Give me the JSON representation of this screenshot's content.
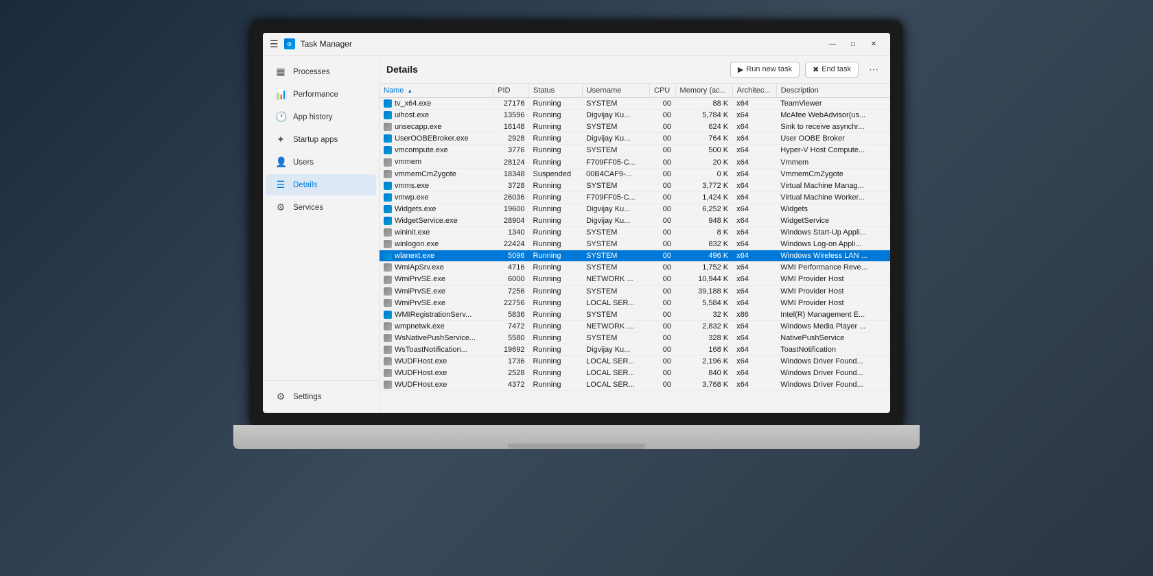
{
  "window": {
    "title": "Task Manager",
    "controls": {
      "minimize": "—",
      "maximize": "□",
      "close": "✕"
    }
  },
  "sidebar": {
    "items": [
      {
        "id": "processes",
        "label": "Processes",
        "icon": "☰"
      },
      {
        "id": "performance",
        "label": "Performance",
        "icon": "📈"
      },
      {
        "id": "app-history",
        "label": "App history",
        "icon": "🕐"
      },
      {
        "id": "startup-apps",
        "label": "Startup apps",
        "icon": "🚀"
      },
      {
        "id": "users",
        "label": "Users",
        "icon": "👤"
      },
      {
        "id": "details",
        "label": "Details",
        "icon": "☰"
      },
      {
        "id": "services",
        "label": "Services",
        "icon": "⚙"
      }
    ],
    "settings": "Settings"
  },
  "toolbar": {
    "tab_title": "Details",
    "run_new_task": "Run new task",
    "end_task": "End task"
  },
  "table": {
    "columns": [
      {
        "id": "name",
        "label": "Name",
        "sorted": true
      },
      {
        "id": "pid",
        "label": "PID"
      },
      {
        "id": "status",
        "label": "Status"
      },
      {
        "id": "username",
        "label": "Username"
      },
      {
        "id": "cpu",
        "label": "CPU"
      },
      {
        "id": "memory",
        "label": "Memory (ac..."
      },
      {
        "id": "arch",
        "label": "Architec..."
      },
      {
        "id": "description",
        "label": "Description"
      }
    ],
    "rows": [
      {
        "name": "tv_x64.exe",
        "pid": "27176",
        "status": "Running",
        "username": "SYSTEM",
        "cpu": "00",
        "memory": "88 K",
        "arch": "x64",
        "description": "TeamViewer",
        "icon": "blue",
        "selected": false,
        "highlighted": false
      },
      {
        "name": "uihost.exe",
        "pid": "13596",
        "status": "Running",
        "username": "Digvijay Ku...",
        "cpu": "00",
        "memory": "5,784 K",
        "arch": "x64",
        "description": "McAfee WebAdvisor(us...",
        "icon": "blue",
        "selected": false,
        "highlighted": false
      },
      {
        "name": "unsecapp.exe",
        "pid": "16148",
        "status": "Running",
        "username": "SYSTEM",
        "cpu": "00",
        "memory": "624 K",
        "arch": "x64",
        "description": "Sink to receive asynchr...",
        "icon": "gray",
        "selected": false,
        "highlighted": false
      },
      {
        "name": "UserOOBEBroker.exe",
        "pid": "2928",
        "status": "Running",
        "username": "Digvijay Ku...",
        "cpu": "00",
        "memory": "764 K",
        "arch": "x64",
        "description": "User OOBE Broker",
        "icon": "blue",
        "selected": false,
        "highlighted": false
      },
      {
        "name": "vmcompute.exe",
        "pid": "3776",
        "status": "Running",
        "username": "SYSTEM",
        "cpu": "00",
        "memory": "500 K",
        "arch": "x64",
        "description": "Hyper-V Host Compute...",
        "icon": "blue",
        "selected": false,
        "highlighted": false
      },
      {
        "name": "vmmem",
        "pid": "28124",
        "status": "Running",
        "username": "F709FF05-C...",
        "cpu": "00",
        "memory": "20 K",
        "arch": "x64",
        "description": "Vmmem",
        "icon": "gray",
        "selected": false,
        "highlighted": false
      },
      {
        "name": "vmmemCmZygote",
        "pid": "18348",
        "status": "Suspended",
        "username": "00B4CAF9-...",
        "cpu": "00",
        "memory": "0 K",
        "arch": "x64",
        "description": "VmmemCmZygote",
        "icon": "gray",
        "selected": false,
        "highlighted": false
      },
      {
        "name": "vmms.exe",
        "pid": "3728",
        "status": "Running",
        "username": "SYSTEM",
        "cpu": "00",
        "memory": "3,772 K",
        "arch": "x64",
        "description": "Virtual Machine Manag...",
        "icon": "blue",
        "selected": false,
        "highlighted": false
      },
      {
        "name": "vmwp.exe",
        "pid": "26036",
        "status": "Running",
        "username": "F709FF05-C...",
        "cpu": "00",
        "memory": "1,424 K",
        "arch": "x64",
        "description": "Virtual Machine Worker...",
        "icon": "blue",
        "selected": false,
        "highlighted": false
      },
      {
        "name": "Widgets.exe",
        "pid": "19600",
        "status": "Running",
        "username": "Digvijay Ku...",
        "cpu": "00",
        "memory": "6,252 K",
        "arch": "x64",
        "description": "Widgets",
        "icon": "blue",
        "selected": false,
        "highlighted": false
      },
      {
        "name": "WidgetService.exe",
        "pid": "28904",
        "status": "Running",
        "username": "Digvijay Ku...",
        "cpu": "00",
        "memory": "948 K",
        "arch": "x64",
        "description": "WidgetService",
        "icon": "blue",
        "selected": false,
        "highlighted": false
      },
      {
        "name": "wininit.exe",
        "pid": "1340",
        "status": "Running",
        "username": "SYSTEM",
        "cpu": "00",
        "memory": "8 K",
        "arch": "x64",
        "description": "Windows Start-Up Appli...",
        "icon": "gray",
        "selected": false,
        "highlighted": false
      },
      {
        "name": "winlogon.exe",
        "pid": "22424",
        "status": "Running",
        "username": "SYSTEM",
        "cpu": "00",
        "memory": "832 K",
        "arch": "x64",
        "description": "Windows Log-on Appli...",
        "icon": "gray",
        "selected": false,
        "highlighted": false
      },
      {
        "name": "wlanext.exe",
        "pid": "5096",
        "status": "Running",
        "username": "SYSTEM",
        "cpu": "00",
        "memory": "496 K",
        "arch": "x64",
        "description": "Windows Wireless LAN ...",
        "icon": "blue",
        "selected": true,
        "highlighted": false
      },
      {
        "name": "WmiApSrv.exe",
        "pid": "4716",
        "status": "Running",
        "username": "SYSTEM",
        "cpu": "00",
        "memory": "1,752 K",
        "arch": "x64",
        "description": "WMI Performance Reve...",
        "icon": "gray",
        "selected": false,
        "highlighted": false
      },
      {
        "name": "WmiPrvSE.exe",
        "pid": "6000",
        "status": "Running",
        "username": "NETWORK ...",
        "cpu": "00",
        "memory": "10,944 K",
        "arch": "x64",
        "description": "WMI Provider Host",
        "icon": "gray",
        "selected": false,
        "highlighted": false
      },
      {
        "name": "WmiPrvSE.exe",
        "pid": "7256",
        "status": "Running",
        "username": "SYSTEM",
        "cpu": "00",
        "memory": "39,188 K",
        "arch": "x64",
        "description": "WMI Provider Host",
        "icon": "gray",
        "selected": false,
        "highlighted": false
      },
      {
        "name": "WmiPrvSE.exe",
        "pid": "22756",
        "status": "Running",
        "username": "LOCAL SER...",
        "cpu": "00",
        "memory": "5,584 K",
        "arch": "x64",
        "description": "WMI Provider Host",
        "icon": "gray",
        "selected": false,
        "highlighted": false
      },
      {
        "name": "WMIRegistrationServ...",
        "pid": "5836",
        "status": "Running",
        "username": "SYSTEM",
        "cpu": "00",
        "memory": "32 K",
        "arch": "x86",
        "description": "Intel(R) Management E...",
        "icon": "blue",
        "selected": false,
        "highlighted": false
      },
      {
        "name": "wmpnetwk.exe",
        "pid": "7472",
        "status": "Running",
        "username": "NETWORK ...",
        "cpu": "00",
        "memory": "2,832 K",
        "arch": "x64",
        "description": "Windows Media Player ...",
        "icon": "gray",
        "selected": false,
        "highlighted": false
      },
      {
        "name": "WsNativePushService...",
        "pid": "5580",
        "status": "Running",
        "username": "SYSTEM",
        "cpu": "00",
        "memory": "328 K",
        "arch": "x64",
        "description": "NativePushService",
        "icon": "gray",
        "selected": false,
        "highlighted": false
      },
      {
        "name": "WsToastNotification...",
        "pid": "19692",
        "status": "Running",
        "username": "Digvijay Ku...",
        "cpu": "00",
        "memory": "168 K",
        "arch": "x64",
        "description": "ToastNotification",
        "icon": "gray",
        "selected": false,
        "highlighted": false
      },
      {
        "name": "WUDFHost.exe",
        "pid": "1736",
        "status": "Running",
        "username": "LOCAL SER...",
        "cpu": "00",
        "memory": "2,196 K",
        "arch": "x64",
        "description": "Windows Driver Found...",
        "icon": "gray",
        "selected": false,
        "highlighted": false
      },
      {
        "name": "WUDFHost.exe",
        "pid": "2528",
        "status": "Running",
        "username": "LOCAL SER...",
        "cpu": "00",
        "memory": "840 K",
        "arch": "x64",
        "description": "Windows Driver Found...",
        "icon": "gray",
        "selected": false,
        "highlighted": false
      },
      {
        "name": "WUDFHost.exe",
        "pid": "4372",
        "status": "Running",
        "username": "LOCAL SER...",
        "cpu": "00",
        "memory": "3,768 K",
        "arch": "x64",
        "description": "Windows Driver Found...",
        "icon": "gray",
        "selected": false,
        "highlighted": false
      }
    ]
  }
}
